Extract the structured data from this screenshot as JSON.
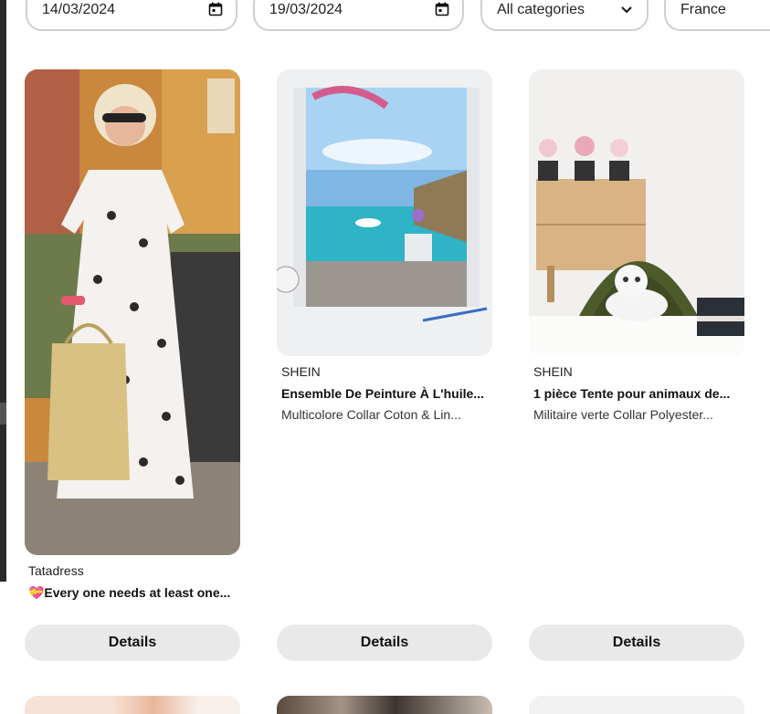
{
  "filters": {
    "start_date": "14/03/2024",
    "end_date": "19/03/2024",
    "category": "All categories",
    "country": "France"
  },
  "cards": [
    {
      "brand": "Tatadress",
      "title": "💝Every one needs at least one...",
      "subtitle": "",
      "button": "Details"
    },
    {
      "brand": "SHEIN",
      "title": "Ensemble De Peinture À L'huile...",
      "subtitle": "Multicolore Collar Coton & Lin...",
      "button": "Details"
    },
    {
      "brand": "SHEIN",
      "title": "1 pièce Tente pour animaux de...",
      "subtitle": "Militaire verte Collar Polyester...",
      "button": "Details"
    }
  ],
  "icons": {
    "date": "calendar-icon",
    "select": "chevron-down-icon"
  },
  "colors": {
    "field_border": "#cfcfcf",
    "button_bg": "#e9e9e9",
    "text": "#111111"
  }
}
